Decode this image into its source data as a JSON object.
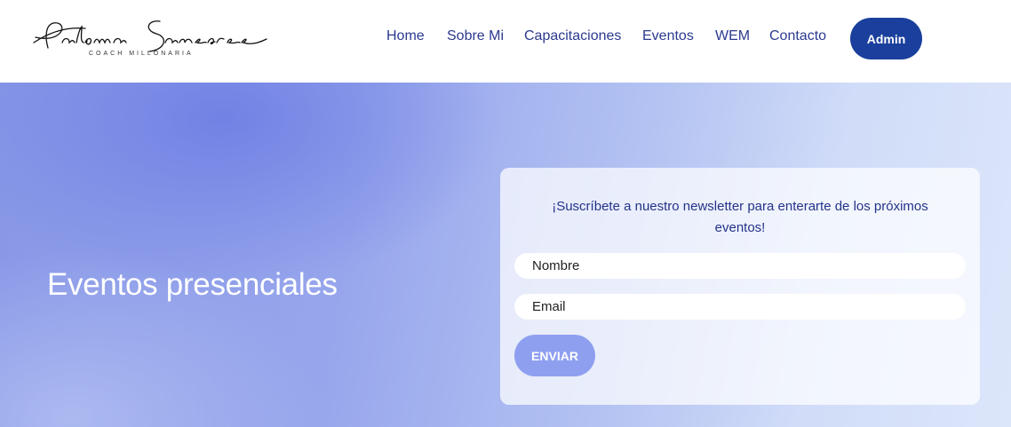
{
  "header": {
    "logo": {
      "name": "Paloma Sansores",
      "tagline": "COACH MILLONARIA"
    },
    "nav": [
      "Home",
      "Sobre Mi",
      "Capacitaciones",
      "Eventos",
      "WEM",
      "Contacto"
    ],
    "admin_label": "Admin"
  },
  "hero": {
    "title": "Eventos presenciales"
  },
  "newsletter": {
    "text": "¡Suscríbete a nuestro newsletter para enterarte de los próximos eventos!",
    "name_placeholder": "Nombre",
    "email_placeholder": "Email",
    "submit_label": "ENVIAR"
  },
  "colors": {
    "nav_text": "#2b3a8f",
    "admin_button": "#1a3f9c",
    "submit_button": "#8f9ff0",
    "hero_gradient_start": "#8797e6",
    "hero_gradient_end": "#dce6fa"
  }
}
